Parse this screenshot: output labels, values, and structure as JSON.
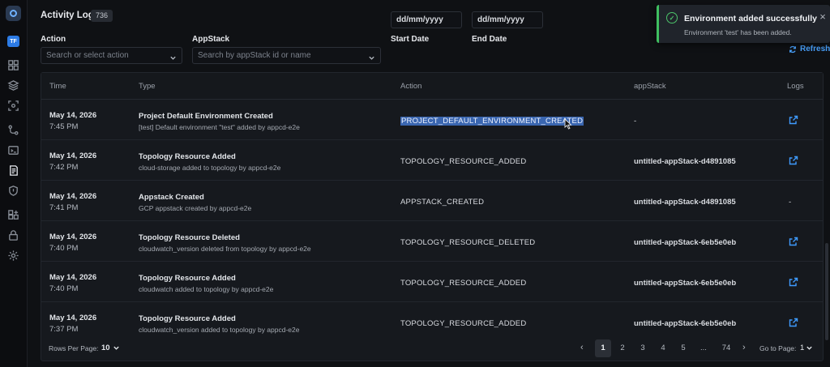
{
  "header": {
    "title": "Activity Logs",
    "count": "736"
  },
  "sidebar": {
    "avatar_initials": "TF",
    "icons": [
      "dashboard-icon",
      "layers-icon",
      "scan-icon",
      "git-branch-icon",
      "terminal-icon",
      "logs-icon",
      "shield-icon",
      "integrations-icon",
      "lock-icon",
      "settings-icon"
    ]
  },
  "filters": {
    "action_label": "Action",
    "action_placeholder": "Search or select action",
    "appstack_label": "AppStack",
    "appstack_placeholder": "Search by appStack id or name",
    "start_label": "Start Date",
    "start_value": "dd/mm/yyyy",
    "end_label": "End Date",
    "end_value": "dd/mm/yyyy"
  },
  "refresh_label": "Refresh",
  "toast": {
    "title": "Environment added successfully",
    "message": "Environment 'test' has been added.",
    "close": "×",
    "color": "#3fbf61"
  },
  "table": {
    "columns": {
      "time": "Time",
      "type": "Type",
      "action": "Action",
      "appstack": "appStack",
      "logs": "Logs"
    },
    "rows": [
      {
        "date": "May 14, 2026",
        "time": "7:45 PM",
        "type_title": "Project Default Environment Created",
        "type_desc": "[test] Default environment \"test\" added by appcd-e2e",
        "action": "PROJECT_DEFAULT_ENVIRONMENT_CREATED",
        "appstack": "-",
        "logs": "link"
      },
      {
        "date": "May 14, 2026",
        "time": "7:42 PM",
        "type_title": "Topology Resource Added",
        "type_desc": "cloud-storage added to topology by appcd-e2e",
        "action": "TOPOLOGY_RESOURCE_ADDED",
        "appstack": "untitled-appStack-d4891085",
        "logs": "link"
      },
      {
        "date": "May 14, 2026",
        "time": "7:41 PM",
        "type_title": "Appstack Created",
        "type_desc": "GCP appstack created by appcd-e2e",
        "action": "APPSTACK_CREATED",
        "appstack": "untitled-appStack-d4891085",
        "logs": "-"
      },
      {
        "date": "May 14, 2026",
        "time": "7:40 PM",
        "type_title": "Topology Resource Deleted",
        "type_desc": "cloudwatch_version deleted from topology by appcd-e2e",
        "action": "TOPOLOGY_RESOURCE_DELETED",
        "appstack": "untitled-appStack-6eb5e0eb",
        "logs": "link"
      },
      {
        "date": "May 14, 2026",
        "time": "7:40 PM",
        "type_title": "Topology Resource Added",
        "type_desc": "cloudwatch added to topology by appcd-e2e",
        "action": "TOPOLOGY_RESOURCE_ADDED",
        "appstack": "untitled-appStack-6eb5e0eb",
        "logs": "link"
      },
      {
        "date": "May 14, 2026",
        "time": "7:37 PM",
        "type_title": "Topology Resource Added",
        "type_desc": "cloudwatch_version added to topology by appcd-e2e",
        "action": "TOPOLOGY_RESOURCE_ADDED",
        "appstack": "untitled-appStack-6eb5e0eb",
        "logs": "link"
      }
    ]
  },
  "pagination": {
    "rows_per_page_label": "Rows Per Page:",
    "rows_per_page_value": "10",
    "pages": [
      "1",
      "2",
      "3",
      "4",
      "5",
      "...",
      "74"
    ],
    "current_page": "1",
    "goto_label": "Go to Page:",
    "goto_value": "1"
  }
}
